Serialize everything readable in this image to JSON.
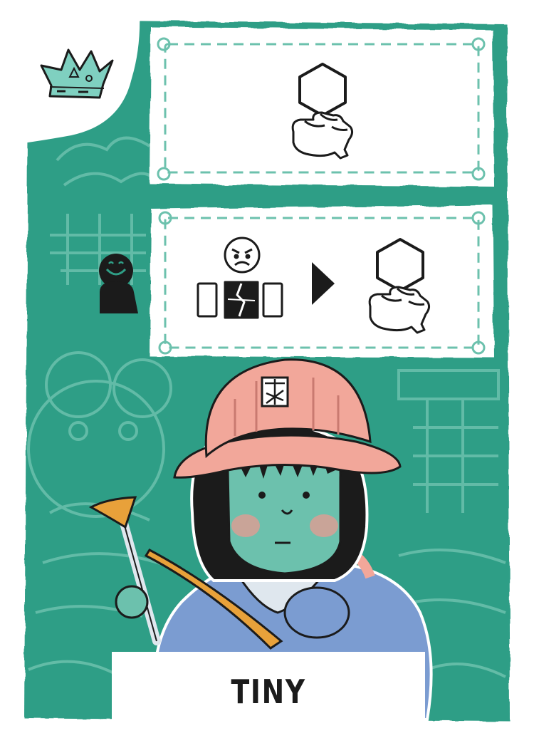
{
  "card": {
    "name": "TINY",
    "colors": {
      "background": "#2f9e86",
      "background_light": "#6cc1ad",
      "panel": "#ffffff",
      "crown": "#7fd0c0",
      "helmet": "#f2a79a",
      "jacket": "#7b9cd1",
      "ink": "#1b1b1b"
    },
    "icons": {
      "rank": "crown-icon",
      "effect_top": [
        "hexagon-icon",
        "open-hand-icon"
      ],
      "player": "meeple-icon",
      "effect_bottom": [
        "angry-face-icon",
        "broken-cards-icon",
        "arrow-right-icon",
        "hexagon-icon",
        "open-hand-icon"
      ]
    }
  }
}
